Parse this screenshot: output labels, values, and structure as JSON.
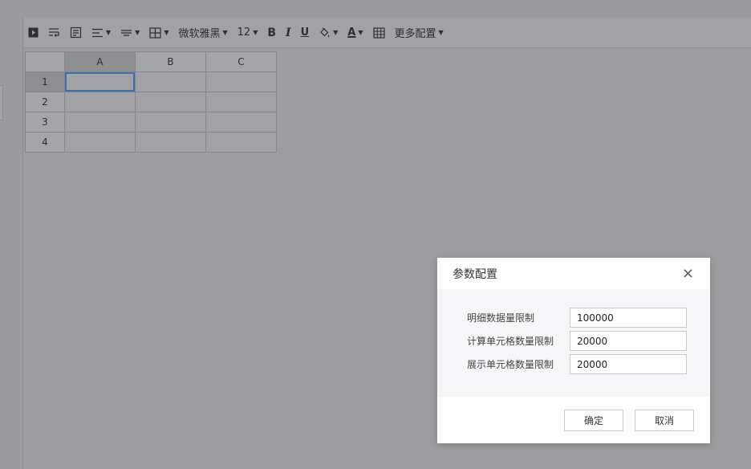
{
  "toolbar": {
    "font_name": "微软雅黑",
    "font_size": "12",
    "bold": "B",
    "italic": "I",
    "underline": "U",
    "font_color_letter": "A",
    "more_config": "更多配置"
  },
  "sheet": {
    "columns": [
      "A",
      "B",
      "C"
    ],
    "rows": [
      "1",
      "2",
      "3",
      "4"
    ],
    "selected_cell": "A1"
  },
  "dialog": {
    "title": "参数配置",
    "close_glyph": "×",
    "fields": [
      {
        "label": "明细数据量限制",
        "value": "100000"
      },
      {
        "label": "计算单元格数量限制",
        "value": "20000"
      },
      {
        "label": "展示单元格数量限制",
        "value": "20000"
      }
    ],
    "confirm_label": "确定",
    "cancel_label": "取消"
  }
}
